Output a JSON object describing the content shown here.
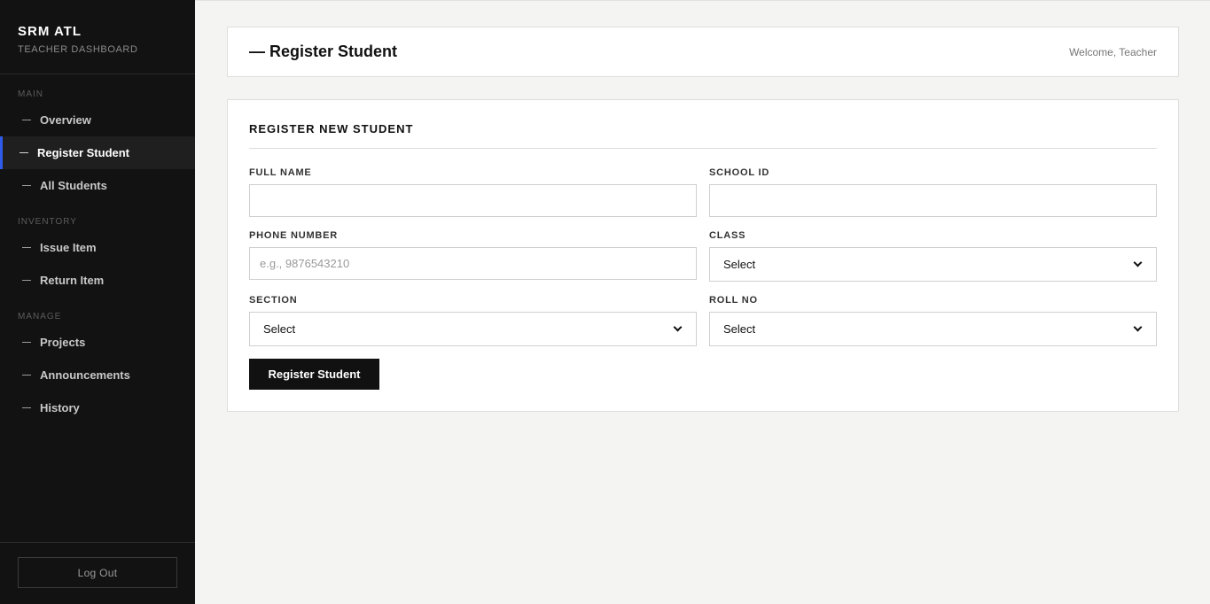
{
  "sidebar": {
    "brand_title": "SRM ATL",
    "brand_subtitle": "TEACHER DASHBOARD",
    "sections": [
      {
        "label": "MAIN",
        "items": [
          {
            "label": "Overview"
          },
          {
            "label": "Register Student",
            "active": true
          },
          {
            "label": "All Students"
          }
        ]
      },
      {
        "label": "INVENTORY",
        "items": [
          {
            "label": "Issue Item"
          },
          {
            "label": "Return Item"
          }
        ]
      },
      {
        "label": "MANAGE",
        "items": [
          {
            "label": "Projects"
          },
          {
            "label": "Announcements"
          },
          {
            "label": "History"
          }
        ]
      }
    ],
    "logout_label": "Log Out",
    "active_color": "#2f5bea"
  },
  "header": {
    "title": "— Register Student",
    "welcome": "Welcome, Teacher"
  },
  "form": {
    "title": "REGISTER NEW STUDENT",
    "full_name": {
      "label": "FULL NAME",
      "value": "",
      "placeholder": ""
    },
    "school_id": {
      "label": "SCHOOL ID",
      "value": "",
      "placeholder": ""
    },
    "phone": {
      "label": "PHONE NUMBER",
      "value": "",
      "placeholder": "e.g., 9876543210"
    },
    "class": {
      "label": "CLASS",
      "selected": "Select"
    },
    "section": {
      "label": "SECTION",
      "selected": "Select"
    },
    "roll_no": {
      "label": "ROLL NO",
      "selected": "Select"
    },
    "submit_label": "Register Student"
  }
}
